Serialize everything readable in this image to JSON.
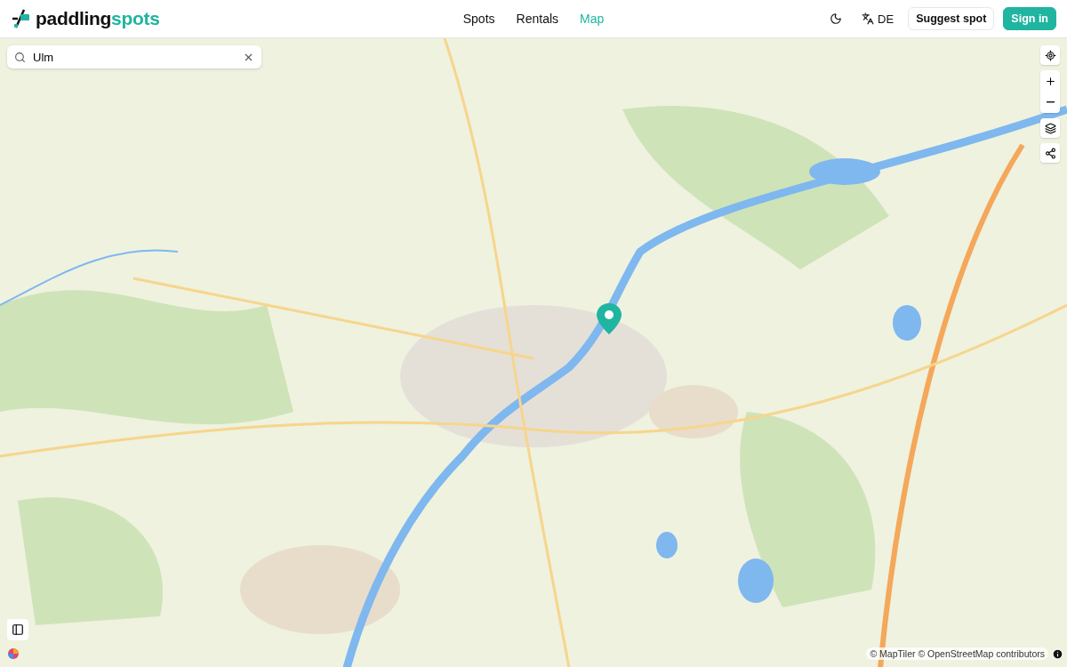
{
  "logo": {
    "prefix": "paddling",
    "accent": "spots"
  },
  "nav": [
    {
      "label": "Spots",
      "selected": false
    },
    {
      "label": "Rentals",
      "selected": false
    },
    {
      "label": "Map",
      "selected": true
    }
  ],
  "language": {
    "code": "DE"
  },
  "buttons": [
    {
      "label": "Suggest spot",
      "kind": "outline"
    },
    {
      "label": "Sign in",
      "kind": "primary"
    }
  ],
  "search": {
    "value": "Ulm"
  },
  "attribution": "© MapTiler © OpenStreetMap contributors"
}
